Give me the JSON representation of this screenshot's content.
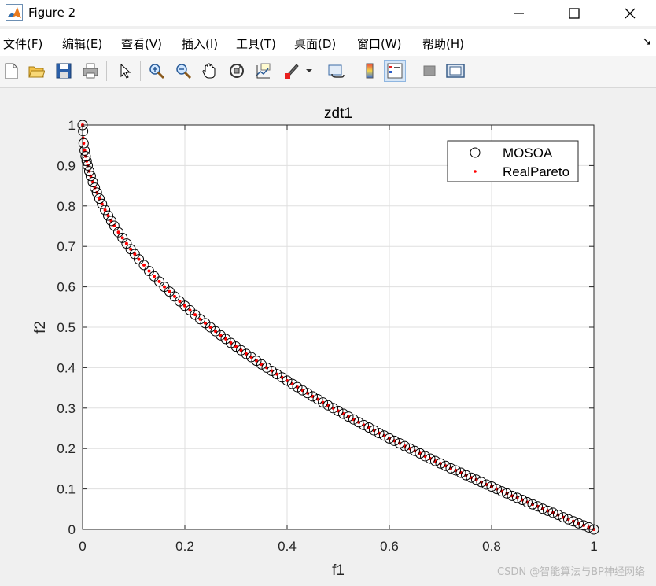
{
  "window": {
    "title": "Figure 2"
  },
  "menu": [
    "文件(F)",
    "编辑(E)",
    "查看(V)",
    "插入(I)",
    "工具(T)",
    "桌面(D)",
    "窗口(W)",
    "帮助(H)"
  ],
  "toolbar": {
    "icons": [
      "new-figure-icon",
      "open-file-icon",
      "save-icon",
      "print-icon",
      "pointer-icon",
      "zoom-in-icon",
      "zoom-out-icon",
      "pan-hand-icon",
      "rotate-3d-icon",
      "data-cursor-icon",
      "brush-icon",
      "link-plot-icon",
      "colorbar-icon",
      "legend-icon",
      "hide-plot-tools-icon",
      "show-plot-tools-icon"
    ]
  },
  "watermark": "CSDN @智能算法与BP神经网络",
  "chart_data": {
    "type": "scatter",
    "title": "zdt1",
    "xlabel": "f1",
    "ylabel": "f2",
    "xlim": [
      0,
      1
    ],
    "ylim": [
      0,
      1
    ],
    "xticks": [
      "0",
      "0.2",
      "0.4",
      "0.6",
      "0.8",
      "1"
    ],
    "yticks": [
      "0",
      "0.1",
      "0.2",
      "0.3",
      "0.4",
      "0.5",
      "0.6",
      "0.7",
      "0.8",
      "0.9",
      "1"
    ],
    "grid": true,
    "legend_position": "top-right",
    "series": [
      {
        "name": "MOSOA",
        "marker": "open-circle",
        "color": "#000000",
        "x": [
          0,
          0.001,
          0.002,
          0.004,
          0.006,
          0.008,
          0.01,
          0.013,
          0.016,
          0.02,
          0.024,
          0.028,
          0.033,
          0.038,
          0.044,
          0.05,
          0.056,
          0.062,
          0.07,
          0.078,
          0.086,
          0.094,
          0.102,
          0.11,
          0.12,
          0.13,
          0.14,
          0.15,
          0.16,
          0.17,
          0.18,
          0.19,
          0.2,
          0.21,
          0.22,
          0.23,
          0.24,
          0.25,
          0.26,
          0.27,
          0.28,
          0.29,
          0.3,
          0.31,
          0.32,
          0.33,
          0.34,
          0.35,
          0.36,
          0.37,
          0.38,
          0.39,
          0.4,
          0.41,
          0.42,
          0.43,
          0.44,
          0.45,
          0.46,
          0.47,
          0.48,
          0.49,
          0.5,
          0.51,
          0.52,
          0.53,
          0.54,
          0.55,
          0.56,
          0.57,
          0.58,
          0.59,
          0.6,
          0.61,
          0.62,
          0.63,
          0.64,
          0.65,
          0.66,
          0.67,
          0.68,
          0.69,
          0.7,
          0.71,
          0.72,
          0.73,
          0.74,
          0.75,
          0.76,
          0.77,
          0.78,
          0.79,
          0.8,
          0.81,
          0.82,
          0.83,
          0.84,
          0.85,
          0.86,
          0.87,
          0.88,
          0.89,
          0.9,
          0.91,
          0.92,
          0.93,
          0.94,
          0.95,
          0.96,
          0.97,
          0.98,
          0.99,
          1
        ],
        "y": [
          1,
          0.985,
          0.955,
          0.937,
          0.923,
          0.911,
          0.9,
          0.886,
          0.874,
          0.859,
          0.845,
          0.833,
          0.818,
          0.805,
          0.79,
          0.776,
          0.763,
          0.751,
          0.735,
          0.721,
          0.707,
          0.693,
          0.681,
          0.668,
          0.654,
          0.639,
          0.626,
          0.613,
          0.6,
          0.588,
          0.576,
          0.564,
          0.553,
          0.542,
          0.531,
          0.52,
          0.51,
          0.5,
          0.49,
          0.48,
          0.471,
          0.461,
          0.452,
          0.443,
          0.434,
          0.426,
          0.417,
          0.408,
          0.4,
          0.392,
          0.384,
          0.376,
          0.368,
          0.36,
          0.352,
          0.344,
          0.337,
          0.329,
          0.322,
          0.314,
          0.307,
          0.3,
          0.293,
          0.286,
          0.279,
          0.272,
          0.265,
          0.258,
          0.252,
          0.245,
          0.238,
          0.232,
          0.225,
          0.219,
          0.213,
          0.206,
          0.2,
          0.194,
          0.188,
          0.181,
          0.175,
          0.169,
          0.163,
          0.157,
          0.151,
          0.146,
          0.14,
          0.134,
          0.128,
          0.123,
          0.117,
          0.111,
          0.106,
          0.1,
          0.094,
          0.089,
          0.083,
          0.078,
          0.073,
          0.067,
          0.062,
          0.057,
          0.051,
          0.046,
          0.041,
          0.036,
          0.03,
          0.025,
          0.02,
          0.015,
          0.01,
          0.005,
          0
        ]
      },
      {
        "name": "RealPareto",
        "marker": "dot",
        "color": "#ff0000",
        "x": [
          0,
          0.001,
          0.002,
          0.004,
          0.006,
          0.008,
          0.01,
          0.013,
          0.016,
          0.02,
          0.024,
          0.028,
          0.033,
          0.038,
          0.044,
          0.05,
          0.056,
          0.062,
          0.07,
          0.078,
          0.086,
          0.094,
          0.102,
          0.11,
          0.12,
          0.13,
          0.14,
          0.15,
          0.16,
          0.17,
          0.18,
          0.19,
          0.2,
          0.21,
          0.22,
          0.23,
          0.24,
          0.25,
          0.26,
          0.27,
          0.28,
          0.29,
          0.3,
          0.31,
          0.32,
          0.33,
          0.34,
          0.35,
          0.36,
          0.37,
          0.38,
          0.39,
          0.4,
          0.41,
          0.42,
          0.43,
          0.44,
          0.45,
          0.46,
          0.47,
          0.48,
          0.49,
          0.5,
          0.51,
          0.52,
          0.53,
          0.54,
          0.55,
          0.56,
          0.57,
          0.58,
          0.59,
          0.6,
          0.61,
          0.62,
          0.63,
          0.64,
          0.65,
          0.66,
          0.67,
          0.68,
          0.69,
          0.7,
          0.71,
          0.72,
          0.73,
          0.74,
          0.75,
          0.76,
          0.77,
          0.78,
          0.79,
          0.8,
          0.81,
          0.82,
          0.83,
          0.84,
          0.85,
          0.86,
          0.87,
          0.88,
          0.89,
          0.9,
          0.91,
          0.92,
          0.93,
          0.94,
          0.95,
          0.96,
          0.97,
          0.98,
          0.99,
          1
        ],
        "y": [
          1,
          0.968,
          0.955,
          0.937,
          0.923,
          0.911,
          0.9,
          0.886,
          0.874,
          0.859,
          0.845,
          0.833,
          0.818,
          0.805,
          0.79,
          0.776,
          0.763,
          0.751,
          0.735,
          0.721,
          0.707,
          0.693,
          0.681,
          0.668,
          0.654,
          0.639,
          0.626,
          0.613,
          0.6,
          0.588,
          0.576,
          0.564,
          0.553,
          0.542,
          0.531,
          0.52,
          0.51,
          0.5,
          0.49,
          0.48,
          0.471,
          0.461,
          0.452,
          0.443,
          0.434,
          0.426,
          0.417,
          0.408,
          0.4,
          0.392,
          0.384,
          0.376,
          0.368,
          0.36,
          0.352,
          0.344,
          0.337,
          0.329,
          0.322,
          0.314,
          0.307,
          0.3,
          0.293,
          0.286,
          0.279,
          0.272,
          0.265,
          0.258,
          0.252,
          0.245,
          0.238,
          0.232,
          0.225,
          0.219,
          0.213,
          0.206,
          0.2,
          0.194,
          0.188,
          0.181,
          0.175,
          0.169,
          0.163,
          0.157,
          0.151,
          0.146,
          0.14,
          0.134,
          0.128,
          0.123,
          0.117,
          0.111,
          0.106,
          0.1,
          0.094,
          0.089,
          0.083,
          0.078,
          0.073,
          0.067,
          0.062,
          0.057,
          0.051,
          0.046,
          0.041,
          0.036,
          0.03,
          0.025,
          0.02,
          0.015,
          0.01,
          0.005,
          0
        ]
      }
    ]
  }
}
